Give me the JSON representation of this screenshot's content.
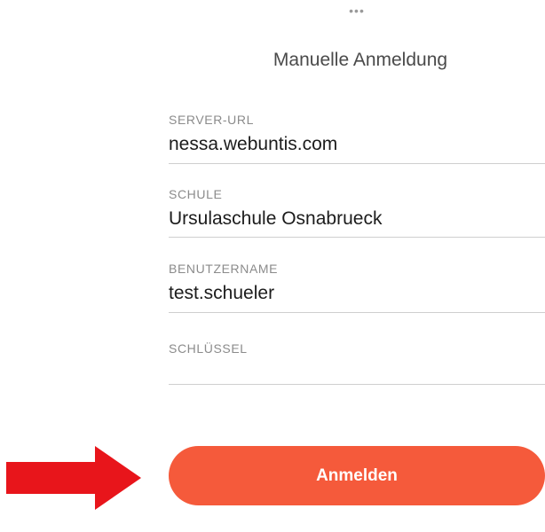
{
  "header": {
    "more_dots": "•••",
    "title": "Manuelle Anmeldung"
  },
  "form": {
    "server_url": {
      "label": "SERVER-URL",
      "value": "nessa.webuntis.com"
    },
    "school": {
      "label": "SCHULE",
      "value": "Ursulaschule Osnabrueck"
    },
    "username": {
      "label": "BENUTZERNAME",
      "value": "test.schueler"
    },
    "key": {
      "label": "SCHLÜSSEL",
      "value": ""
    }
  },
  "login_button": {
    "label": "Anmelden"
  },
  "annotation": {
    "arrow_icon": "red-arrow-right-icon"
  },
  "colors": {
    "accent": "#f55a3b",
    "arrow": "#e8151b",
    "label": "#8b8b8b",
    "divider": "#cfcfcf"
  }
}
